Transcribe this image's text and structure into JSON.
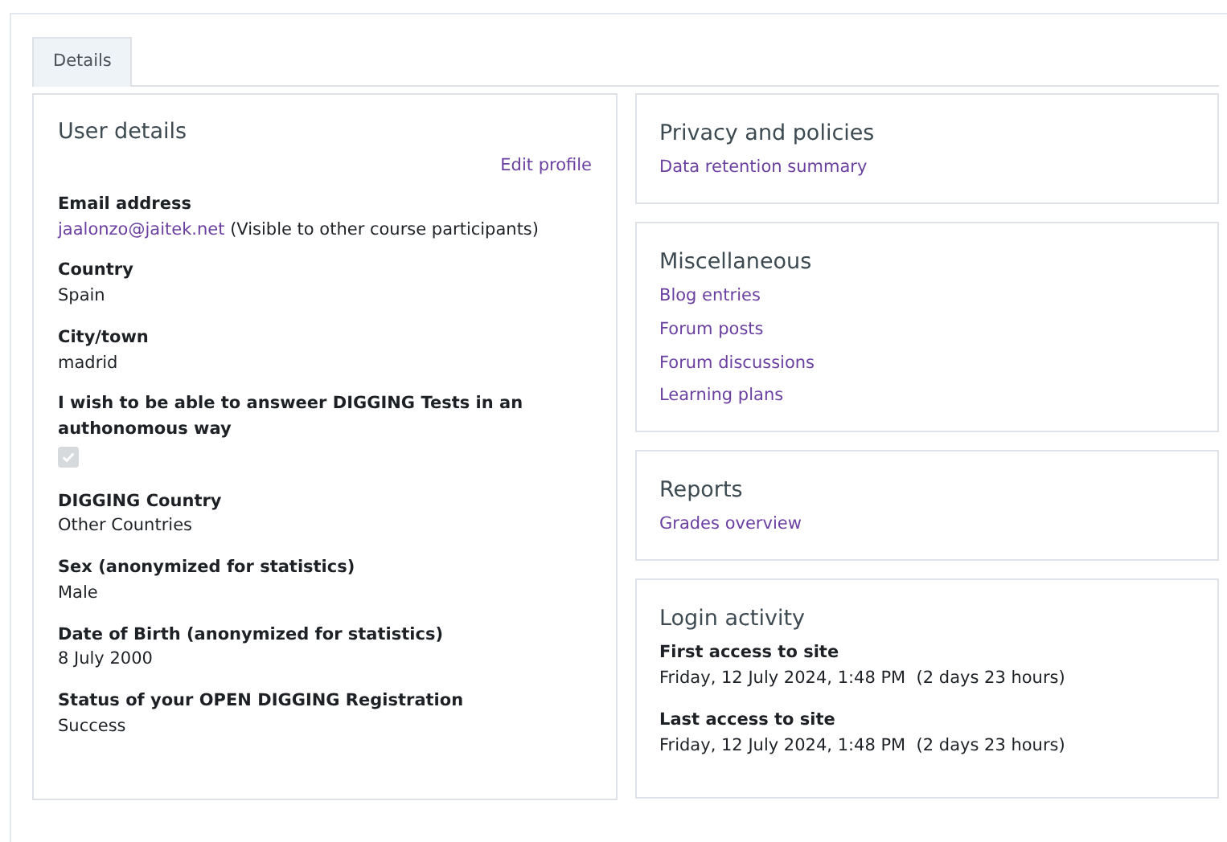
{
  "tabs": [
    {
      "label": "Details",
      "selected": true
    }
  ],
  "user_details": {
    "title": "User details",
    "edit_link": "Edit profile",
    "fields": [
      {
        "kind": "email",
        "label": "Email address",
        "link": "jaalonzo@jaitek.net",
        "note": "(Visible to other course participants)"
      },
      {
        "kind": "text",
        "label": "Country",
        "value": "Spain"
      },
      {
        "kind": "text",
        "label": "City/town",
        "value": "madrid"
      },
      {
        "kind": "checkbox",
        "label": "I wish to be able to answeer DIGGING Tests in an authonomous way",
        "checked": true,
        "disabled": true
      },
      {
        "kind": "text",
        "label": "DIGGING Country",
        "value": "Other Countries"
      },
      {
        "kind": "text",
        "label": "Sex (anonymized for statistics)",
        "value": "Male"
      },
      {
        "kind": "text",
        "label": "Date of Birth (anonymized for statistics)",
        "value": "8 July 2000"
      },
      {
        "kind": "text",
        "label": "Status of your OPEN DIGGING Registration",
        "value": "Success"
      }
    ]
  },
  "sections": [
    {
      "kind": "links",
      "title": "Privacy and policies",
      "links": [
        "Data retention summary"
      ]
    },
    {
      "kind": "links",
      "title": "Miscellaneous",
      "links": [
        "Blog entries",
        "Forum posts",
        "Forum discussions",
        "Learning plans"
      ]
    },
    {
      "kind": "links",
      "title": "Reports",
      "links": [
        "Grades overview"
      ]
    },
    {
      "kind": "fields",
      "title": "Login activity",
      "fields": [
        {
          "label": "First access to site",
          "value": "Friday, 12 July 2024, 1:48 PM  (2 days 23 hours)"
        },
        {
          "label": "Last access to site",
          "value": "Friday, 12 July 2024, 1:48 PM  (2 days 23 hours)"
        }
      ]
    }
  ]
}
